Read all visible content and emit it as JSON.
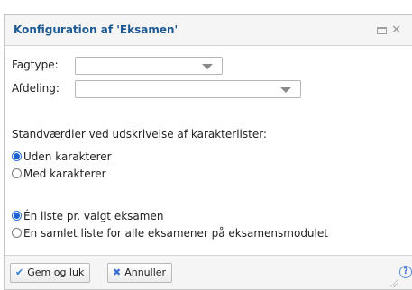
{
  "dialog": {
    "title": "Konfiguration af 'Eksamen'",
    "window_icons": [
      "maximize-icon",
      "close-icon"
    ],
    "close_glyph": "✕"
  },
  "form": {
    "fagtype_label": "Fagtype:",
    "fagtype_value": "",
    "afdeling_label": "Afdeling:",
    "afdeling_value": "",
    "defaults_heading": "Standværdier ved udskrivelse af karakterlister:",
    "grade_options": [
      {
        "label": "Uden karakterer",
        "checked": true
      },
      {
        "label": "Med karakterer",
        "checked": false
      }
    ],
    "list_options": [
      {
        "label": "Én liste pr. valgt eksamen",
        "checked": true
      },
      {
        "label": "En samlet liste for alle eksamener på eksamensmodulet",
        "checked": false
      }
    ]
  },
  "footer": {
    "save_label": "Gem og luk",
    "cancel_label": "Annuller",
    "save_icon": "checkmark-icon",
    "cancel_icon": "x-icon",
    "help_glyph": "?"
  },
  "colors": {
    "title": "#1e5a94",
    "accent": "#2b6fd6",
    "bar_bg": "#f5f5f5",
    "border": "#c5c5c5"
  }
}
